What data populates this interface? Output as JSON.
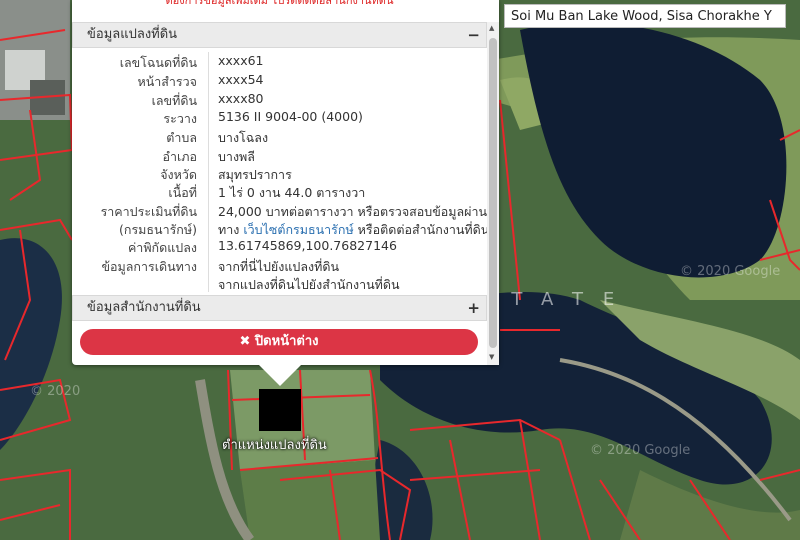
{
  "location_label": "Soi Mu Ban Lake Wood, Sisa Chorakhe Y",
  "popup": {
    "warning": "ต้องการข้อมูลเพิ่มเติม โปรดติดต่อสำนักงานที่ดิน",
    "land_info": {
      "title": "ข้อมูลแปลงที่ดิน",
      "toggle": "−",
      "rows": [
        {
          "key": "เลขโฉนดที่ดิน",
          "value": "xxxx61"
        },
        {
          "key": "หน้าสำรวจ",
          "value": "xxxx54"
        },
        {
          "key": "เลขที่ดิน",
          "value": "xxxx80"
        },
        {
          "key": "ระวาง",
          "value": "5136 II 9004-00 (4000)"
        },
        {
          "key": "ตำบล",
          "value": "บางโฉลง"
        },
        {
          "key": "อำเภอ",
          "value": "บางพลี"
        },
        {
          "key": "จังหวัด",
          "value": "สมุทรปราการ"
        },
        {
          "key": "เนื้อที่",
          "value": "1 ไร่ 0 งาน 44.0 ตารางวา"
        }
      ],
      "price_key_1": "ราคาประเมินที่ดิน",
      "price_key_2": "(กรมธนารักษ์)",
      "price_value_1": "24,000 บาทต่อตารางวา หรือตรวจสอบข้อมูลผ่าน",
      "price_value_2a": "ทาง ",
      "price_link": "เว็บไซต์กรมธนารักษ์",
      "price_value_2b": " หรือติดต่อสำนักงานที่ดิน",
      "coord_key": "ค่าพิกัดแปลง",
      "coord_value": "13.61745869,100.76827146",
      "travel_key": "ข้อมูลการเดินทาง",
      "travel_link_1": "จากที่นี่ไปยังแปลงที่ดิน",
      "travel_link_2": "จากแปลงที่ดินไปยังสำนักงานที่ดิน"
    },
    "office_info": {
      "title": "ข้อมูลสำนักงานที่ดิน",
      "toggle": "+"
    },
    "close_label": "✖ ปิดหน้าต่าง"
  },
  "marker_label": "ตำแหน่งแปลงที่ดิน",
  "watermarks": {
    "estate": "STATE",
    "google_1": "© 2020 Google",
    "google_2": "© 2020 Google",
    "google_3": "© 2020"
  },
  "colors": {
    "close_button": "#dc3545",
    "parcel_lines": "#e8282c",
    "link": "#2a6fb0",
    "water": "#0f1d33"
  }
}
